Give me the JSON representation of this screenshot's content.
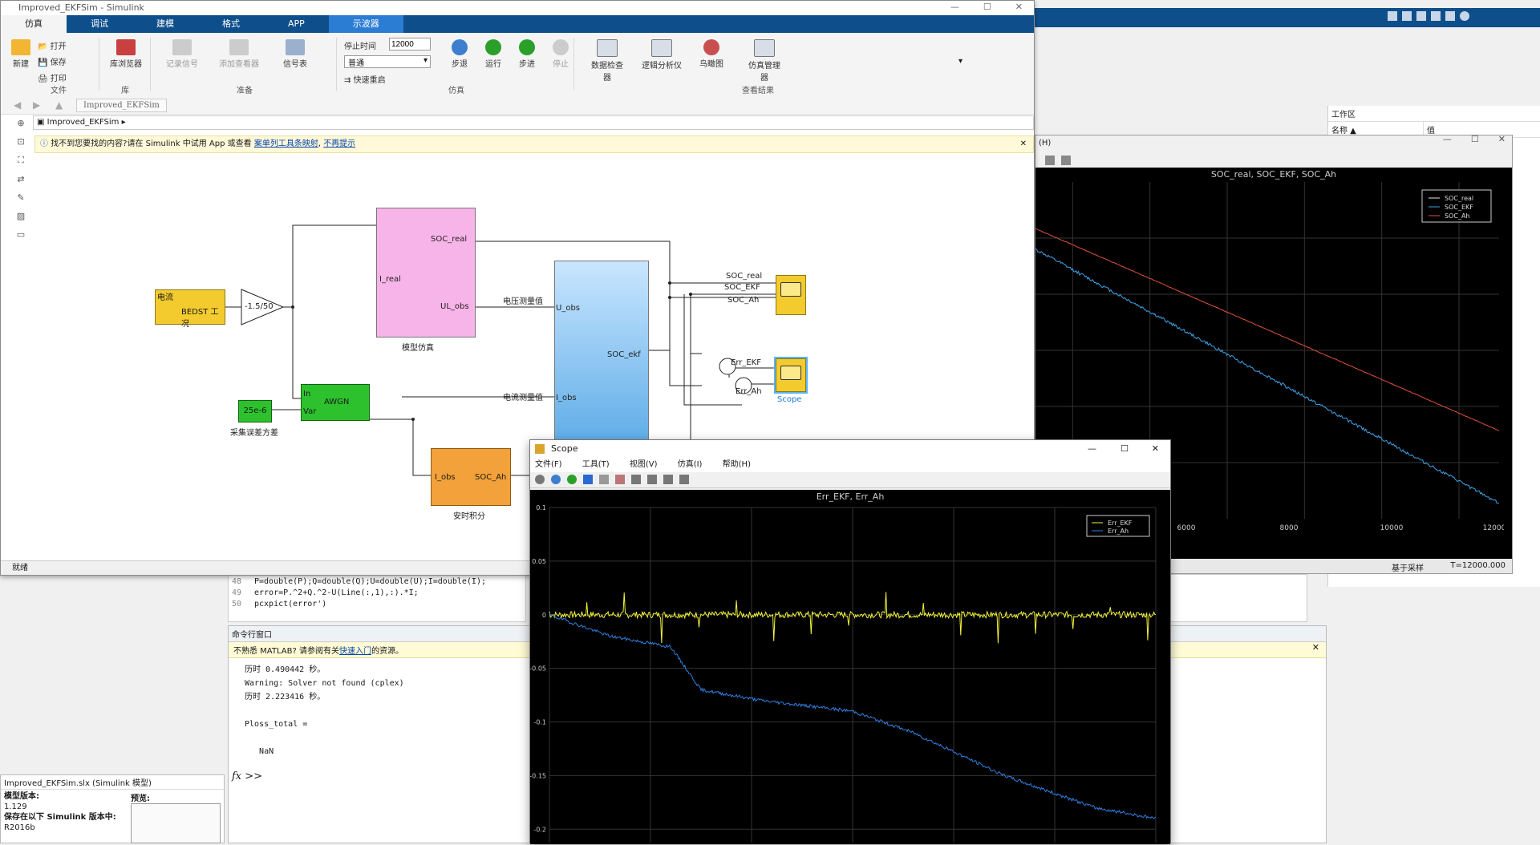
{
  "simulink": {
    "title": "Improved_EKFSim - Simulink",
    "tabs": [
      "仿真",
      "调试",
      "建模",
      "格式",
      "APP",
      "示波器"
    ],
    "ribbon": {
      "new": "新建",
      "open": "打开",
      "save": "保存",
      "print": "打印",
      "file_group": "文件",
      "library": "库浏览器",
      "lib_group": "库",
      "log_signals": "记录信号",
      "add_viewer": "添加查看器",
      "signal_table": "信号表",
      "prepare_group": "准备",
      "stop_time_label": "停止时间",
      "stop_time": "12000",
      "mode": "普通",
      "fast_restart": "快速重启",
      "step_back": "步退",
      "run": "运行",
      "step_fwd": "步进",
      "stop": "停止",
      "sim_group": "仿真",
      "data_inspector": "数据检查器",
      "logic_analyzer": "逻辑分析仪",
      "bird_eye": "鸟瞰图",
      "sim_manager": "仿真管理器",
      "review_group": "查看结果"
    },
    "breadcrumb_tab": "Improved_EKFSim",
    "address": "Improved_EKFSim",
    "notice": "找不到您要找的内容?请在 Simulink 中试用 App 或查看",
    "notice_link": "案单列工具条映射",
    "notice_link2": "不再提示",
    "status": "就绪",
    "blocks": {
      "source_title": "电流",
      "source_label": "BEDST 工况",
      "gain": "-1.5/50",
      "model_sim": "模型仿真",
      "port_ireal": "I_real",
      "port_socreal": "SOC_real",
      "port_ulobs": "UL_obs",
      "volt_meas": "电压测量值",
      "curr_meas": "电流测量值",
      "ekf_in1": "U_obs",
      "ekf_in2": "I_obs",
      "ekf_out": "SOC_ekf",
      "const": "25e-6",
      "const_label": "采集误差方差",
      "awgn": "AWGN",
      "awgn_in": "In",
      "awgn_var": "Var",
      "ah_in": "I_obs",
      "ah_out": "SOC_Ah",
      "ah_label": "安时积分",
      "sig_soc_real": "SOC_real",
      "sig_soc_ekf": "SOC_EKF",
      "sig_soc_ah": "SOC_Ah",
      "sig_err_ekf": "Err_EKF",
      "sig_err_ah": "Err_Ah",
      "scope2_label": "Scope"
    }
  },
  "matlab": {
    "toolbar_right": "工作区",
    "workspace_cols": [
      "名称 ▲",
      "值"
    ],
    "editor_lines": [
      {
        "n": "48",
        "t": "P=double(P);Q=double(Q);U=double(U);I=double(I);"
      },
      {
        "n": "49",
        "t": "error=P.^2+Q.^2-U(Line(:,1),:).*I;"
      },
      {
        "n": "50",
        "t": "pcxpict(error')"
      }
    ],
    "cmd_title": "命令行窗口",
    "cmd_notice": "不熟悉 MATLAB? 请参阅有关",
    "cmd_notice_link": "快速入门",
    "cmd_notice_tail": "的资源。",
    "cmd_lines": [
      "历时 0.490442 秒。",
      "Warning: Solver not found (cplex)",
      "历时 2.223416 秒。",
      "",
      "Ploss_total =",
      "",
      "   NaN"
    ],
    "prompt": "fx >>",
    "detail_file": "Improved_EKFSim.slx (Simulink 模型)",
    "detail_version_label": "模型版本:",
    "detail_version": "1.129",
    "detail_saved_label": "保存在以下 Simulink 版本中:",
    "detail_saved": "R2016b",
    "preview_label": "预览:"
  },
  "scope1": {
    "menu_tail": "(H)",
    "title": "SOC_real, SOC_EKF, SOC_Ah",
    "legend": [
      "SOC_real",
      "SOC_EKF",
      "SOC_Ah"
    ],
    "status_left": "基于采样",
    "status_right": "T=12000.000"
  },
  "scope2": {
    "title": "Scope",
    "menu": [
      "文件(F)",
      "工具(T)",
      "视图(V)",
      "仿真(I)",
      "帮助(H)"
    ],
    "plot_title": "Err_EKF, Err_Ah",
    "legend": [
      "Err_EKF",
      "Err_Ah"
    ]
  },
  "chart_data": [
    {
      "type": "line",
      "title": "SOC_real, SOC_EKF, SOC_Ah",
      "x_ticks": [
        "6000",
        "8000",
        "10000",
        "12000"
      ],
      "xlim": [
        5000,
        12000
      ],
      "grid": true,
      "legend_position": "top-right",
      "series": [
        {
          "name": "SOC_real",
          "color": "#e8e8e8",
          "x": [
            5000,
            12000
          ],
          "y": [
            0.86,
            0.47
          ]
        },
        {
          "name": "SOC_EKF",
          "color": "#3da3e8",
          "x": [
            5000,
            12000
          ],
          "y": [
            0.82,
            0.33
          ]
        },
        {
          "name": "SOC_Ah",
          "color": "#e0523a",
          "x": [
            5000,
            12000
          ],
          "y": [
            0.86,
            0.47
          ]
        }
      ]
    },
    {
      "type": "line",
      "title": "Err_EKF, Err_Ah",
      "y_ticks": [
        "0.1",
        "0.05",
        "0",
        "-0.05",
        "-0.1",
        "-0.15",
        "-0.2"
      ],
      "ylim": [
        -0.2,
        0.1
      ],
      "grid": true,
      "legend_position": "top-right",
      "series": [
        {
          "name": "Err_EKF",
          "color": "#f2f23a",
          "x": [
            0,
            1
          ],
          "y": [
            0.0,
            0.0
          ]
        },
        {
          "name": "Err_Ah",
          "color": "#2f7fe0",
          "x": [
            0,
            0.1,
            0.2,
            0.25,
            0.35,
            0.5,
            0.6,
            0.75,
            0.9,
            1.0
          ],
          "y": [
            0.0,
            -0.02,
            -0.03,
            -0.07,
            -0.08,
            -0.09,
            -0.11,
            -0.15,
            -0.18,
            -0.19
          ]
        }
      ]
    }
  ]
}
